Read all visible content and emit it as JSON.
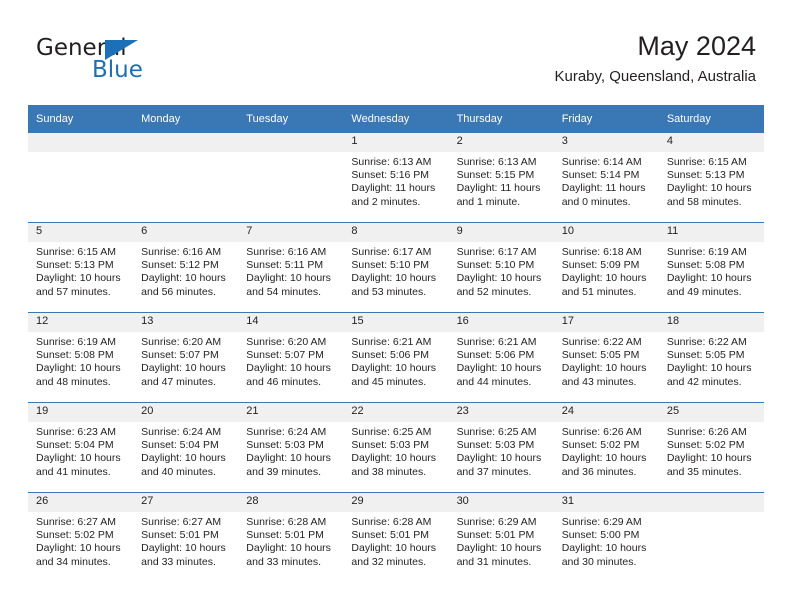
{
  "brand": {
    "name_part1": "General",
    "name_part2": "Blue",
    "triangle_color": "#1b70b8",
    "text_color": "#231f20"
  },
  "header": {
    "title": "May 2024",
    "subtitle": "Kuraby, Queensland, Australia"
  },
  "theme": {
    "header_bg": "#3a77b5",
    "header_text": "#ffffff",
    "daynum_band_bg": "#f0f0f0",
    "grid_line": "#3a77b5",
    "body_text": "#231f20"
  },
  "weekday_headers": [
    "Sunday",
    "Monday",
    "Tuesday",
    "Wednesday",
    "Thursday",
    "Friday",
    "Saturday"
  ],
  "weeks": [
    [
      {
        "day": "",
        "empty": true,
        "sunrise": "",
        "sunset": "",
        "daylight_line1": "",
        "daylight_line2": ""
      },
      {
        "day": "",
        "empty": true,
        "sunrise": "",
        "sunset": "",
        "daylight_line1": "",
        "daylight_line2": ""
      },
      {
        "day": "",
        "empty": true,
        "sunrise": "",
        "sunset": "",
        "daylight_line1": "",
        "daylight_line2": ""
      },
      {
        "day": "1",
        "empty": false,
        "sunrise": "Sunrise: 6:13 AM",
        "sunset": "Sunset: 5:16 PM",
        "daylight_line1": "Daylight: 11 hours",
        "daylight_line2": "and 2 minutes."
      },
      {
        "day": "2",
        "empty": false,
        "sunrise": "Sunrise: 6:13 AM",
        "sunset": "Sunset: 5:15 PM",
        "daylight_line1": "Daylight: 11 hours",
        "daylight_line2": "and 1 minute."
      },
      {
        "day": "3",
        "empty": false,
        "sunrise": "Sunrise: 6:14 AM",
        "sunset": "Sunset: 5:14 PM",
        "daylight_line1": "Daylight: 11 hours",
        "daylight_line2": "and 0 minutes."
      },
      {
        "day": "4",
        "empty": false,
        "sunrise": "Sunrise: 6:15 AM",
        "sunset": "Sunset: 5:13 PM",
        "daylight_line1": "Daylight: 10 hours",
        "daylight_line2": "and 58 minutes."
      }
    ],
    [
      {
        "day": "5",
        "empty": false,
        "sunrise": "Sunrise: 6:15 AM",
        "sunset": "Sunset: 5:13 PM",
        "daylight_line1": "Daylight: 10 hours",
        "daylight_line2": "and 57 minutes."
      },
      {
        "day": "6",
        "empty": false,
        "sunrise": "Sunrise: 6:16 AM",
        "sunset": "Sunset: 5:12 PM",
        "daylight_line1": "Daylight: 10 hours",
        "daylight_line2": "and 56 minutes."
      },
      {
        "day": "7",
        "empty": false,
        "sunrise": "Sunrise: 6:16 AM",
        "sunset": "Sunset: 5:11 PM",
        "daylight_line1": "Daylight: 10 hours",
        "daylight_line2": "and 54 minutes."
      },
      {
        "day": "8",
        "empty": false,
        "sunrise": "Sunrise: 6:17 AM",
        "sunset": "Sunset: 5:10 PM",
        "daylight_line1": "Daylight: 10 hours",
        "daylight_line2": "and 53 minutes."
      },
      {
        "day": "9",
        "empty": false,
        "sunrise": "Sunrise: 6:17 AM",
        "sunset": "Sunset: 5:10 PM",
        "daylight_line1": "Daylight: 10 hours",
        "daylight_line2": "and 52 minutes."
      },
      {
        "day": "10",
        "empty": false,
        "sunrise": "Sunrise: 6:18 AM",
        "sunset": "Sunset: 5:09 PM",
        "daylight_line1": "Daylight: 10 hours",
        "daylight_line2": "and 51 minutes."
      },
      {
        "day": "11",
        "empty": false,
        "sunrise": "Sunrise: 6:19 AM",
        "sunset": "Sunset: 5:08 PM",
        "daylight_line1": "Daylight: 10 hours",
        "daylight_line2": "and 49 minutes."
      }
    ],
    [
      {
        "day": "12",
        "empty": false,
        "sunrise": "Sunrise: 6:19 AM",
        "sunset": "Sunset: 5:08 PM",
        "daylight_line1": "Daylight: 10 hours",
        "daylight_line2": "and 48 minutes."
      },
      {
        "day": "13",
        "empty": false,
        "sunrise": "Sunrise: 6:20 AM",
        "sunset": "Sunset: 5:07 PM",
        "daylight_line1": "Daylight: 10 hours",
        "daylight_line2": "and 47 minutes."
      },
      {
        "day": "14",
        "empty": false,
        "sunrise": "Sunrise: 6:20 AM",
        "sunset": "Sunset: 5:07 PM",
        "daylight_line1": "Daylight: 10 hours",
        "daylight_line2": "and 46 minutes."
      },
      {
        "day": "15",
        "empty": false,
        "sunrise": "Sunrise: 6:21 AM",
        "sunset": "Sunset: 5:06 PM",
        "daylight_line1": "Daylight: 10 hours",
        "daylight_line2": "and 45 minutes."
      },
      {
        "day": "16",
        "empty": false,
        "sunrise": "Sunrise: 6:21 AM",
        "sunset": "Sunset: 5:06 PM",
        "daylight_line1": "Daylight: 10 hours",
        "daylight_line2": "and 44 minutes."
      },
      {
        "day": "17",
        "empty": false,
        "sunrise": "Sunrise: 6:22 AM",
        "sunset": "Sunset: 5:05 PM",
        "daylight_line1": "Daylight: 10 hours",
        "daylight_line2": "and 43 minutes."
      },
      {
        "day": "18",
        "empty": false,
        "sunrise": "Sunrise: 6:22 AM",
        "sunset": "Sunset: 5:05 PM",
        "daylight_line1": "Daylight: 10 hours",
        "daylight_line2": "and 42 minutes."
      }
    ],
    [
      {
        "day": "19",
        "empty": false,
        "sunrise": "Sunrise: 6:23 AM",
        "sunset": "Sunset: 5:04 PM",
        "daylight_line1": "Daylight: 10 hours",
        "daylight_line2": "and 41 minutes."
      },
      {
        "day": "20",
        "empty": false,
        "sunrise": "Sunrise: 6:24 AM",
        "sunset": "Sunset: 5:04 PM",
        "daylight_line1": "Daylight: 10 hours",
        "daylight_line2": "and 40 minutes."
      },
      {
        "day": "21",
        "empty": false,
        "sunrise": "Sunrise: 6:24 AM",
        "sunset": "Sunset: 5:03 PM",
        "daylight_line1": "Daylight: 10 hours",
        "daylight_line2": "and 39 minutes."
      },
      {
        "day": "22",
        "empty": false,
        "sunrise": "Sunrise: 6:25 AM",
        "sunset": "Sunset: 5:03 PM",
        "daylight_line1": "Daylight: 10 hours",
        "daylight_line2": "and 38 minutes."
      },
      {
        "day": "23",
        "empty": false,
        "sunrise": "Sunrise: 6:25 AM",
        "sunset": "Sunset: 5:03 PM",
        "daylight_line1": "Daylight: 10 hours",
        "daylight_line2": "and 37 minutes."
      },
      {
        "day": "24",
        "empty": false,
        "sunrise": "Sunrise: 6:26 AM",
        "sunset": "Sunset: 5:02 PM",
        "daylight_line1": "Daylight: 10 hours",
        "daylight_line2": "and 36 minutes."
      },
      {
        "day": "25",
        "empty": false,
        "sunrise": "Sunrise: 6:26 AM",
        "sunset": "Sunset: 5:02 PM",
        "daylight_line1": "Daylight: 10 hours",
        "daylight_line2": "and 35 minutes."
      }
    ],
    [
      {
        "day": "26",
        "empty": false,
        "sunrise": "Sunrise: 6:27 AM",
        "sunset": "Sunset: 5:02 PM",
        "daylight_line1": "Daylight: 10 hours",
        "daylight_line2": "and 34 minutes."
      },
      {
        "day": "27",
        "empty": false,
        "sunrise": "Sunrise: 6:27 AM",
        "sunset": "Sunset: 5:01 PM",
        "daylight_line1": "Daylight: 10 hours",
        "daylight_line2": "and 33 minutes."
      },
      {
        "day": "28",
        "empty": false,
        "sunrise": "Sunrise: 6:28 AM",
        "sunset": "Sunset: 5:01 PM",
        "daylight_line1": "Daylight: 10 hours",
        "daylight_line2": "and 33 minutes."
      },
      {
        "day": "29",
        "empty": false,
        "sunrise": "Sunrise: 6:28 AM",
        "sunset": "Sunset: 5:01 PM",
        "daylight_line1": "Daylight: 10 hours",
        "daylight_line2": "and 32 minutes."
      },
      {
        "day": "30",
        "empty": false,
        "sunrise": "Sunrise: 6:29 AM",
        "sunset": "Sunset: 5:01 PM",
        "daylight_line1": "Daylight: 10 hours",
        "daylight_line2": "and 31 minutes."
      },
      {
        "day": "31",
        "empty": false,
        "sunrise": "Sunrise: 6:29 AM",
        "sunset": "Sunset: 5:00 PM",
        "daylight_line1": "Daylight: 10 hours",
        "daylight_line2": "and 30 minutes."
      },
      {
        "day": "",
        "empty": true,
        "sunrise": "",
        "sunset": "",
        "daylight_line1": "",
        "daylight_line2": ""
      }
    ]
  ]
}
